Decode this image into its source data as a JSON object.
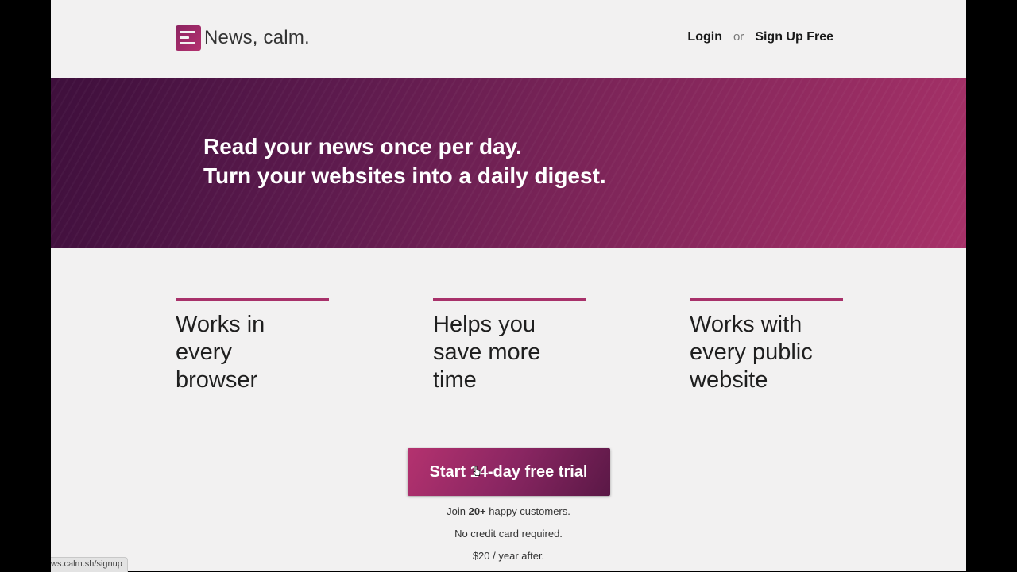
{
  "header": {
    "logo_text": "News, calm.",
    "nav": {
      "login": "Login",
      "or": "or",
      "signup": "Sign Up Free"
    }
  },
  "hero": {
    "line1": "Read your news once per day.",
    "line2": "Turn your websites into a daily digest."
  },
  "features": [
    {
      "line1": "Works in",
      "line2": "every",
      "line3": "browser"
    },
    {
      "line1": "Helps you",
      "line2": "save more",
      "line3": "time"
    },
    {
      "line1": "Works with",
      "line2": "every public",
      "line3": "website"
    }
  ],
  "cta": {
    "label": "Start 14-day free trial",
    "customers_prefix": "Join ",
    "customers_count": "20+",
    "customers_suffix": " happy customers.",
    "no_card": "No credit card required.",
    "price": "$20 / year after."
  },
  "status_bar": {
    "url": "ws.calm.sh/signup"
  },
  "colors": {
    "accent": "#a8316a",
    "hero_start": "#3e0f3c",
    "hero_end": "#a73168",
    "background": "#f2f1f1"
  }
}
